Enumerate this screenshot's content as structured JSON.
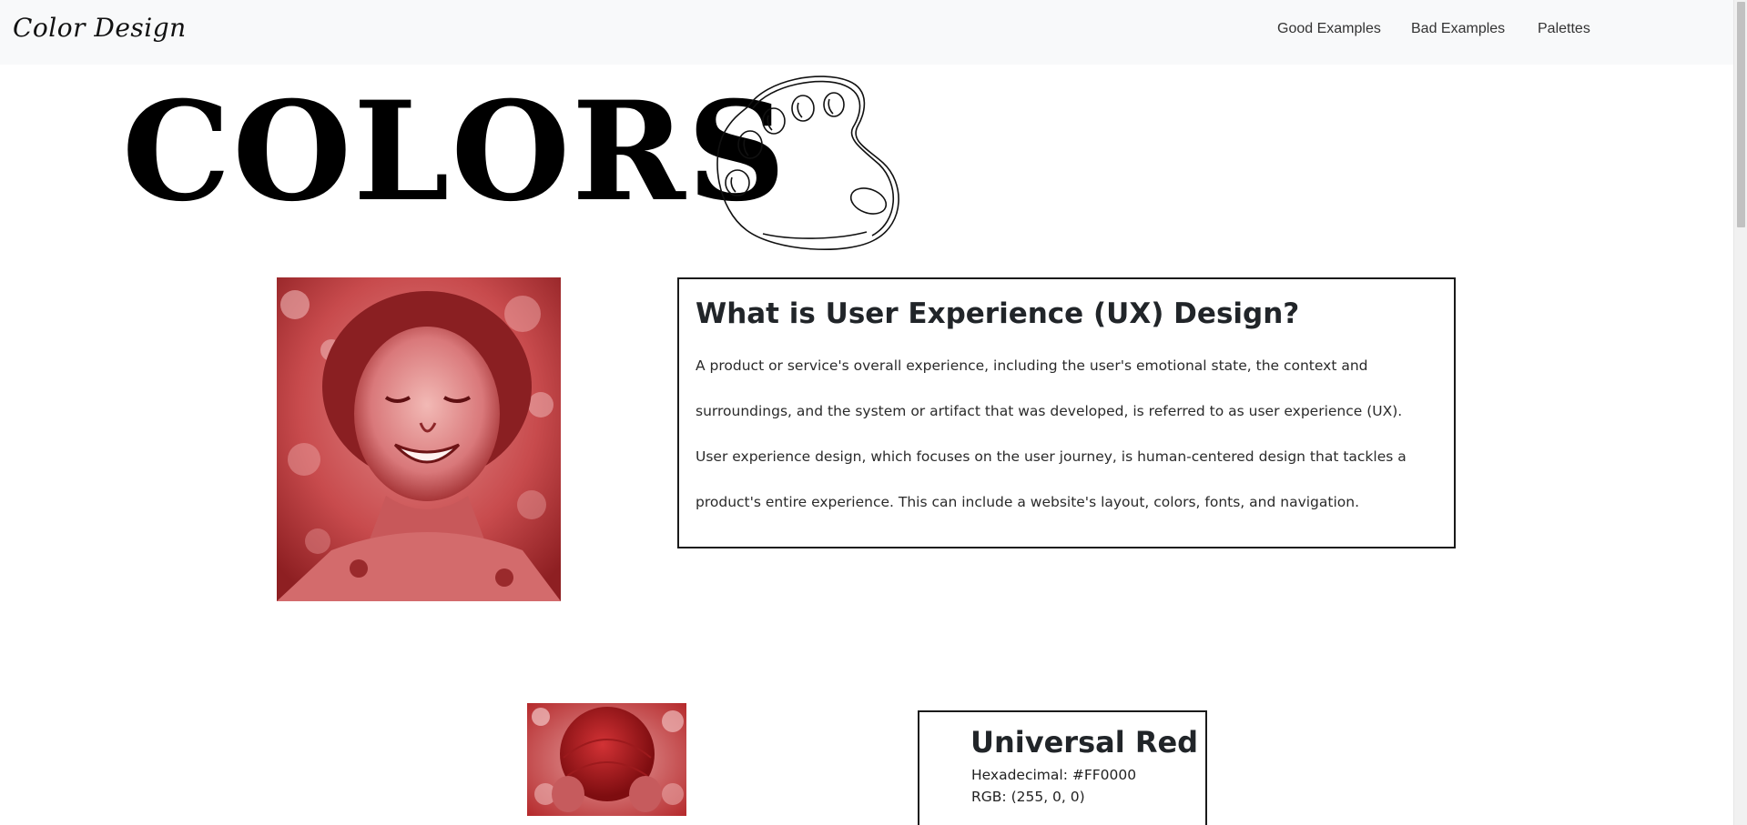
{
  "navbar": {
    "brand": "Color Design",
    "links": [
      "Good Examples",
      "Bad Examples",
      "Palettes"
    ]
  },
  "hero": {
    "title": "COLORS",
    "icon": "palette-icon"
  },
  "info": {
    "title": "What is User Experience (UX) Design?",
    "body": "A product or service's overall experience, including the user's emotional state, the context and surroundings, and the system or artifact that was developed, is referred to as user experience (UX). User experience design, which focuses on the user journey, is human-centered design that tackles a product's entire experience. This can include a website's layout, colors, fonts, and navigation."
  },
  "color_card": {
    "title": "Universal Red",
    "hex_line": "Hexadecimal: #FF0000",
    "rgb_line": "RGB: (255, 0, 0)"
  },
  "colors": {
    "photo_tint": "#c0393b",
    "navbar_bg": "#f8f9fa"
  }
}
